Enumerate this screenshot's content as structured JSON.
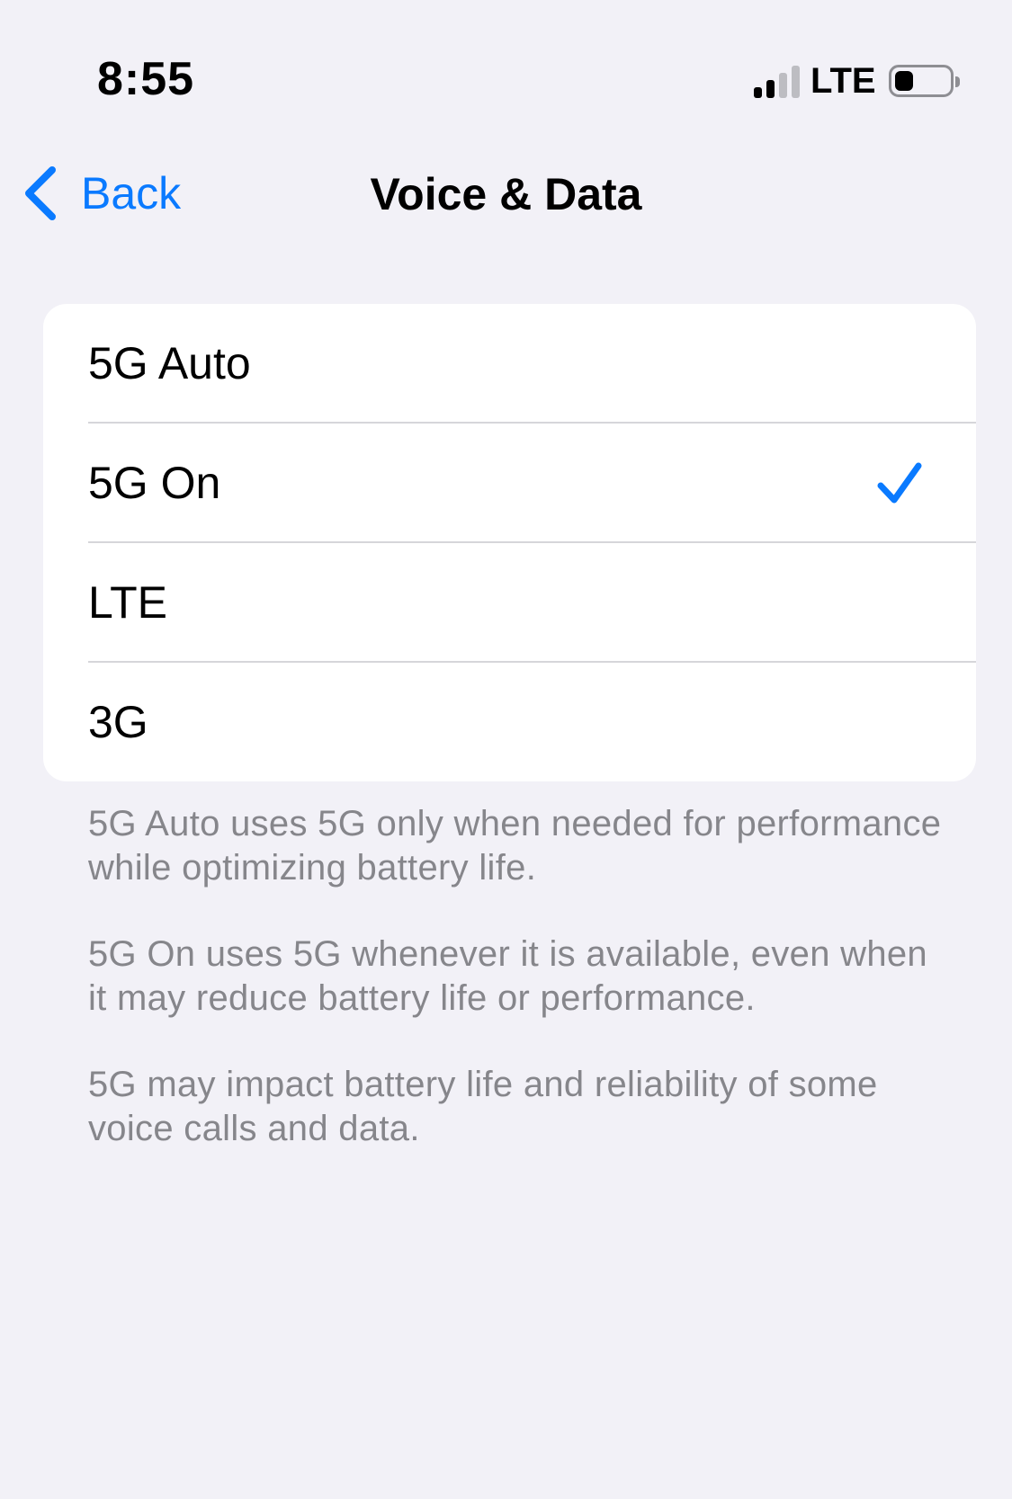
{
  "status_bar": {
    "time": "8:55",
    "carrier": "LTE",
    "signal_bars_active": 2,
    "signal_bars_total": 4,
    "battery_level": 0.35,
    "icons": [
      "cellular-signal-icon",
      "battery-icon"
    ]
  },
  "nav": {
    "back_label": "Back",
    "title": "Voice & Data",
    "back_icon": "chevron-left-icon"
  },
  "options": [
    {
      "label": "5G Auto",
      "selected": false
    },
    {
      "label": "5G On",
      "selected": true
    },
    {
      "label": "LTE",
      "selected": false
    },
    {
      "label": "3G",
      "selected": false
    }
  ],
  "footer": {
    "notes": [
      "5G Auto uses 5G only when needed for performance while optimizing battery life.",
      "5G On uses 5G whenever it is available, even when it may reduce battery life or performance.",
      "5G may impact battery life and reliability of some voice calls and data."
    ]
  },
  "colors": {
    "background": "#f2f1f7",
    "accent": "#0a7aff",
    "footer_text": "#86868b",
    "card": "#ffffff"
  }
}
